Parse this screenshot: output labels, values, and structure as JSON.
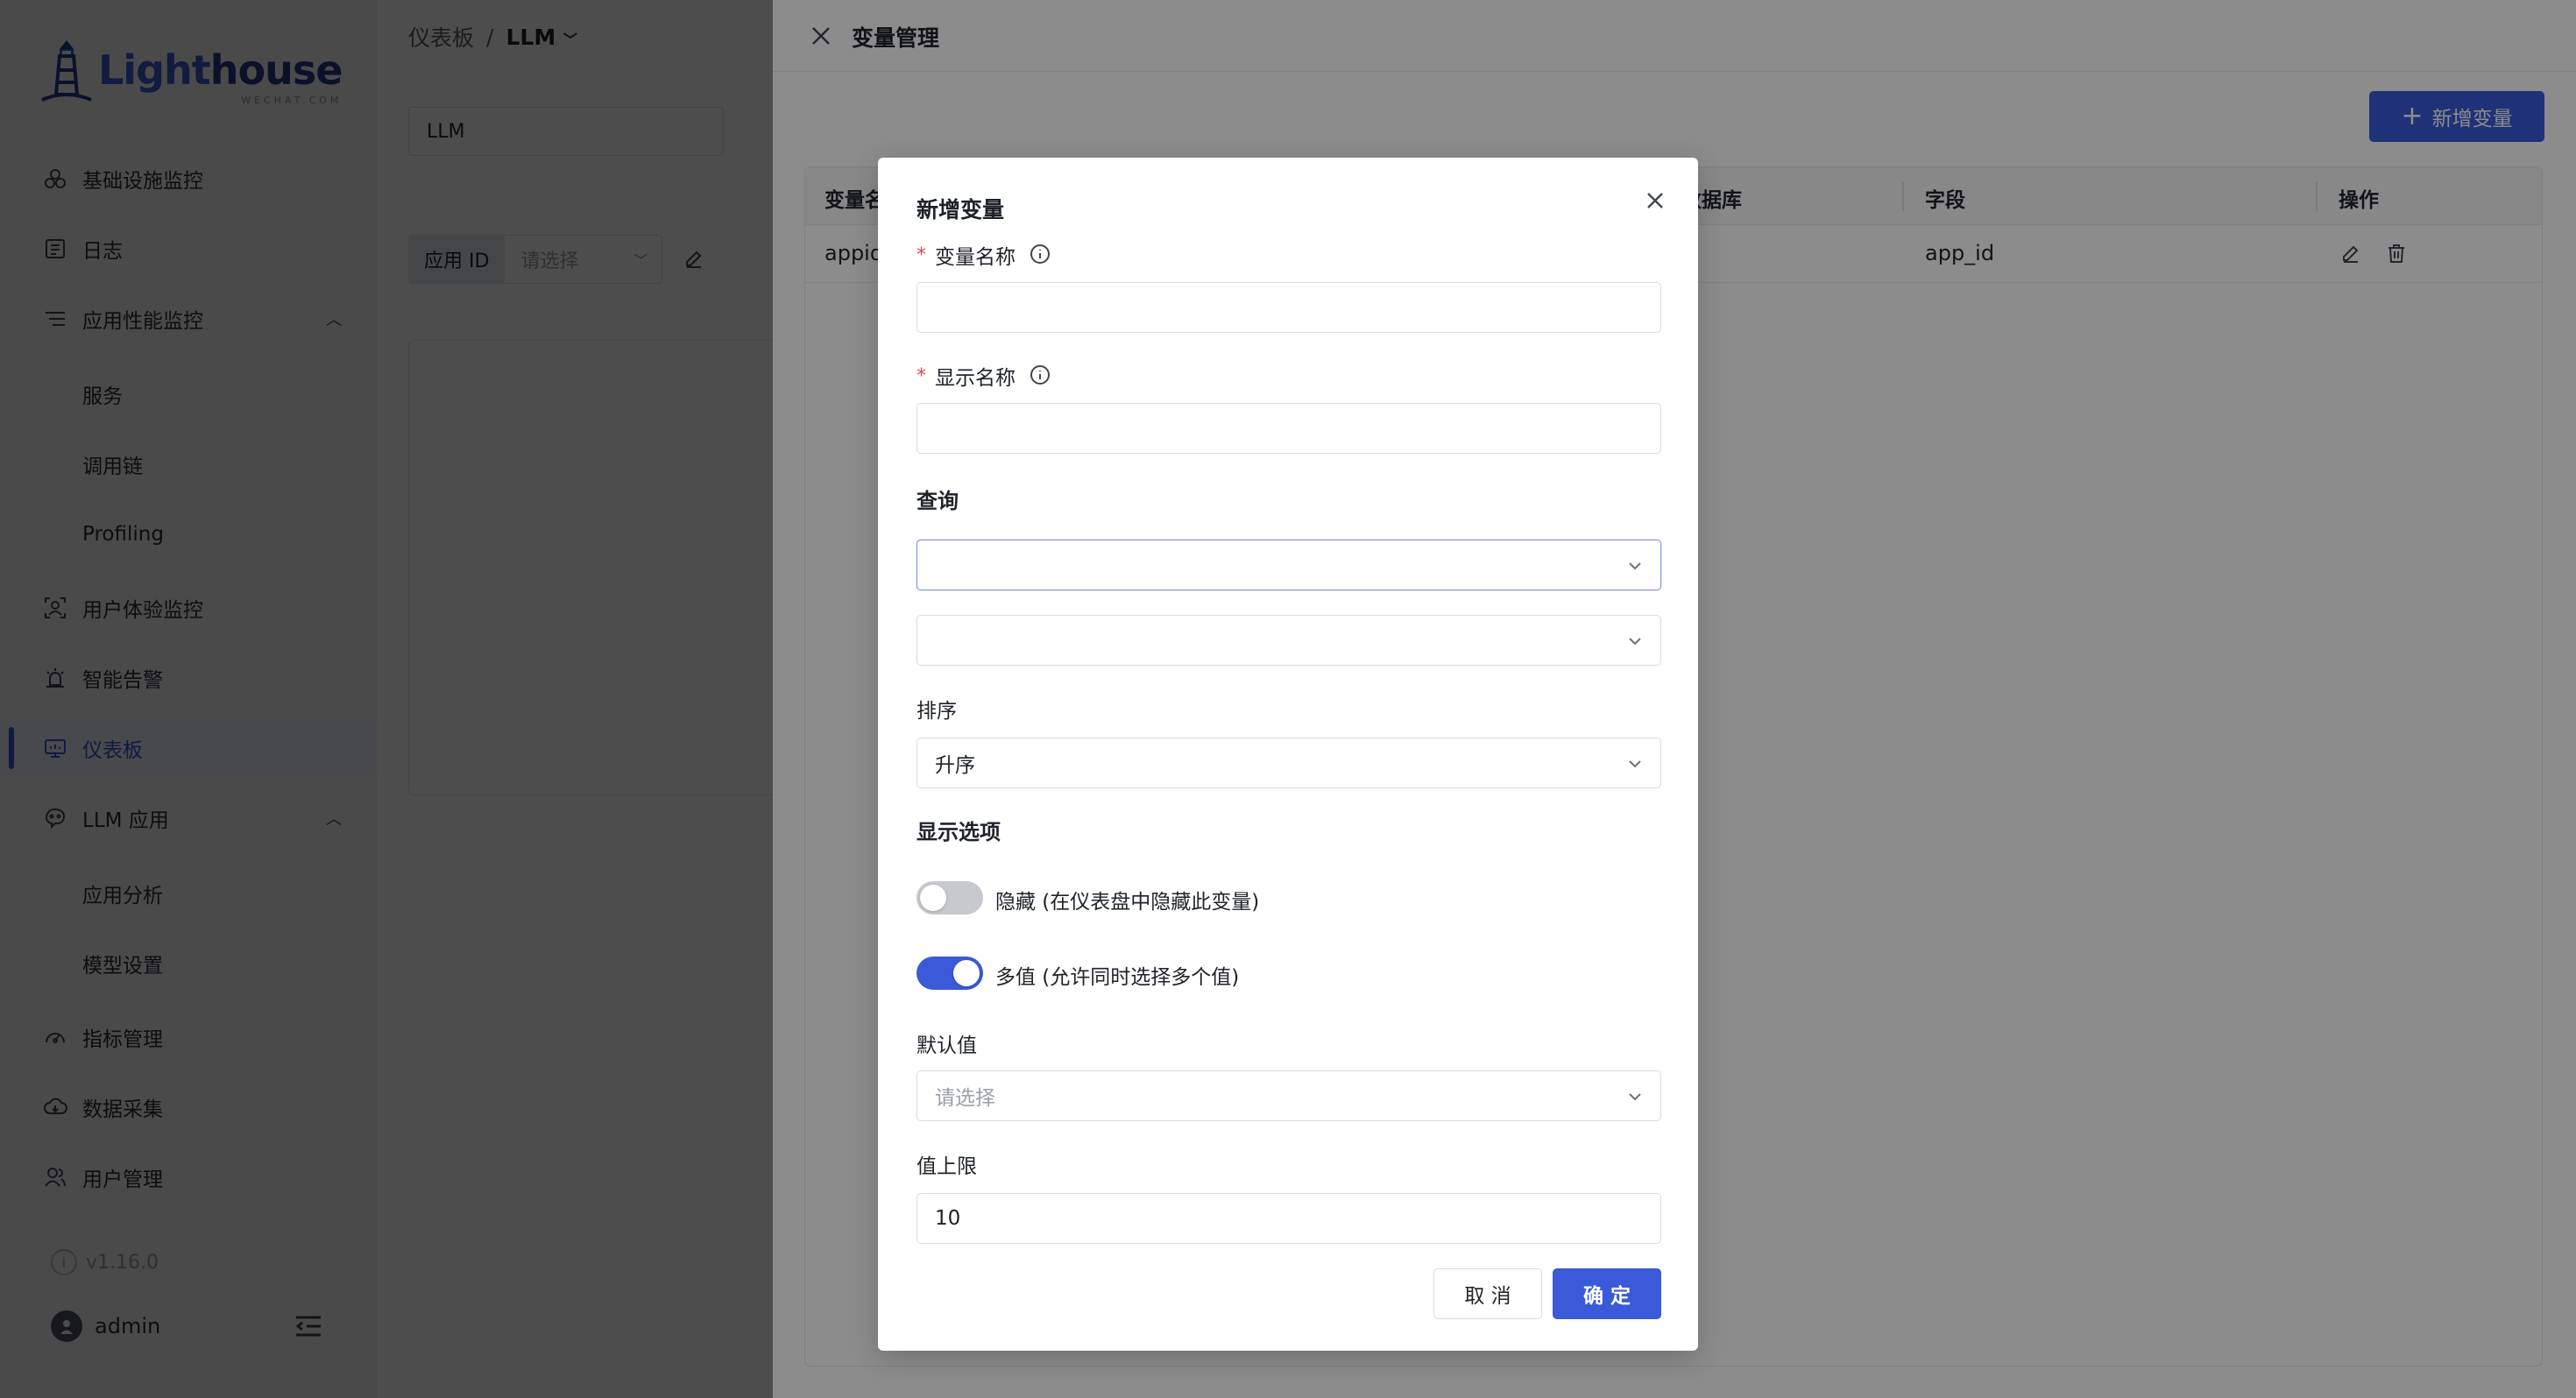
{
  "logo": {
    "text_a": "Light",
    "text_b": "house",
    "sub": "WECHAT.COM"
  },
  "sidebar": {
    "items": [
      {
        "label": "基础设施监控",
        "icon": "infrastructure-icon"
      },
      {
        "label": "日志",
        "icon": "log-icon"
      },
      {
        "label": "应用性能监控",
        "icon": "apm-icon",
        "expanded": true
      },
      {
        "label": "服务"
      },
      {
        "label": "调用链"
      },
      {
        "label": "Profiling"
      },
      {
        "label": "用户体验监控",
        "icon": "user-experience-icon"
      },
      {
        "label": "智能告警",
        "icon": "alert-icon"
      },
      {
        "label": "仪表板",
        "icon": "dashboard-icon",
        "active": true
      },
      {
        "label": "LLM 应用",
        "icon": "llm-icon",
        "expanded": true
      },
      {
        "label": "应用分析"
      },
      {
        "label": "模型设置"
      },
      {
        "label": "指标管理",
        "icon": "metrics-icon"
      },
      {
        "label": "数据采集",
        "icon": "data-collection-icon"
      },
      {
        "label": "用户管理",
        "icon": "user-management-icon"
      }
    ],
    "version": "v1.16.0",
    "username": "admin"
  },
  "main": {
    "breadcrumb_root": "仪表板",
    "breadcrumb_sep": "/",
    "breadcrumb_current": "LLM",
    "dashboard_name": "LLM",
    "var_chip_name": "应用 ID",
    "var_chip_placeholder": "请选择"
  },
  "drawer": {
    "title": "变量管理",
    "add_button": "新增变量",
    "columns": [
      "变量名",
      "数据库",
      "字段",
      "操作"
    ],
    "rows": [
      {
        "name": "appid",
        "field": "app_id"
      }
    ]
  },
  "modal": {
    "title": "新增变量",
    "var_name_label": "变量名称",
    "display_name_label": "显示名称",
    "query_label": "查询",
    "sort_label": "排序",
    "sort_value": "升序",
    "display_options_label": "显示选项",
    "hide_label": "隐藏 (在仪表盘中隐藏此变量)",
    "hide_on": false,
    "multi_label": "多值 (允许同时选择多个值)",
    "multi_on": true,
    "default_label": "默认值",
    "default_placeholder": "请选择",
    "limit_label": "值上限",
    "limit_value": "10",
    "cancel_label": "取 消",
    "ok_label": "确 定"
  },
  "colors": {
    "primary": "#3a5ad9",
    "required": "#e5484d"
  }
}
